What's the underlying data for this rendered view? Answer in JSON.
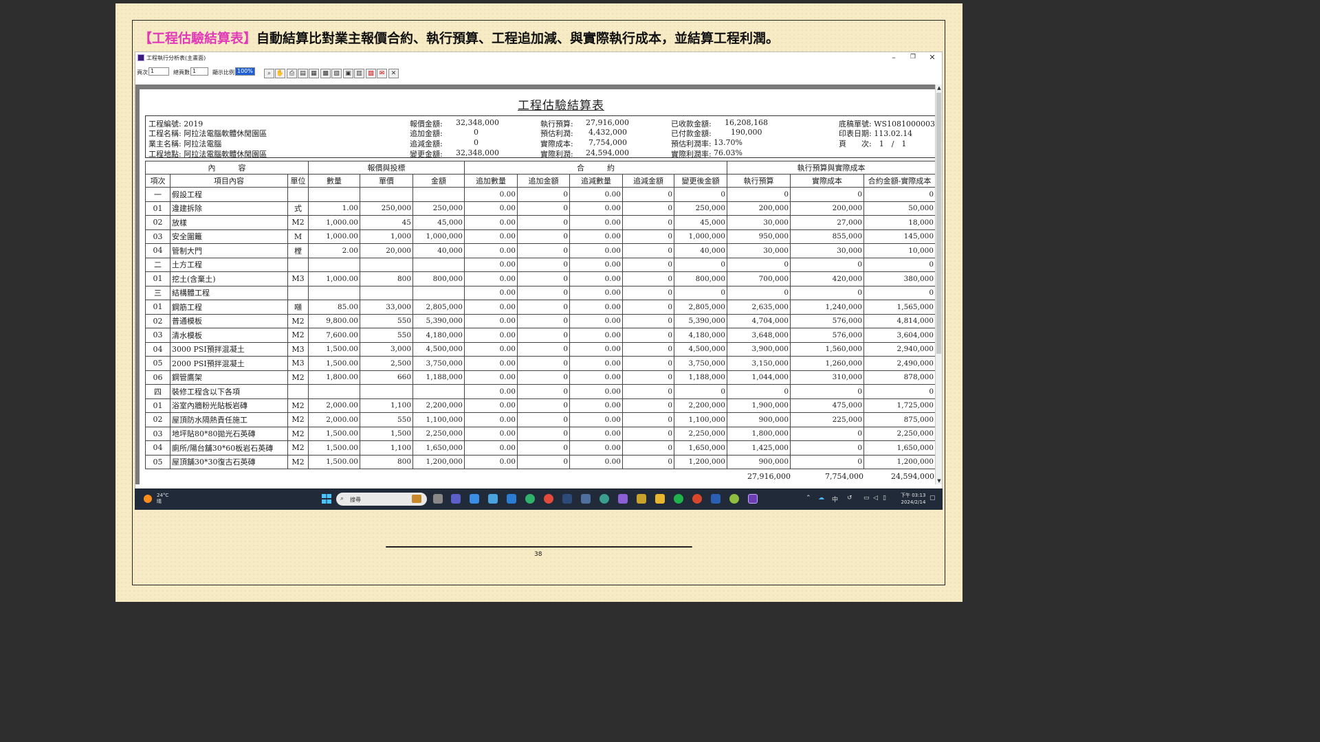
{
  "headline": {
    "tag": "【工程估驗結算表】",
    "text": "自動結算比對業主報價合約、執行預算、工程追加減、與實際執行成本，並結算工程利潤。"
  },
  "window": {
    "title": "工程執行分析表(主畫面)",
    "controls": {
      "minimize": "–",
      "restore": "❐",
      "close": "✕"
    }
  },
  "toolbar": {
    "page_label": "頁次",
    "page_value": "1",
    "total_label": "總頁數",
    "total_value": "1",
    "zoom_label": "顯示比例",
    "zoom_value": "100%"
  },
  "report": {
    "title": "工程估驗結算表",
    "info": {
      "project_no": "工程編號: 2019",
      "project_name": "工程名稱: 阿拉法電腦軟體休閒園區",
      "owner": "業主名稱: 阿拉法電腦",
      "location": "工程地點: 阿拉法電腦軟體休閒園區",
      "quote_label": "報價金額:",
      "quote_value": "32,348,000",
      "add_label": "追加金額:",
      "add_value": "0",
      "sub_label": "追減金額:",
      "sub_value": "0",
      "change_label": "變更金額:",
      "change_value": "32,348,000",
      "budget_label": "執行預算:",
      "budget_value": "27,916,000",
      "est_profit_label": "預估利潤:",
      "est_profit_value": "4,432,000",
      "actual_cost_label": "實際成本:",
      "actual_cost_value": "7,754,000",
      "actual_profit_label": "實際利潤:",
      "actual_profit_value": "24,594,000",
      "received_label": "已收款金額:",
      "received_value": "16,208,168",
      "paid_label": "已付款金額:",
      "paid_value": "190,000",
      "est_rate_label": "預估利潤率:",
      "est_rate_value": "13.70%",
      "actual_rate_label": "實際利潤率:",
      "actual_rate_value": "76.03%",
      "doc_no": "底稿單號: WS1081000003",
      "print_date": "印表日期: 113.02.14",
      "page_info": "頁　　次:　1　/　1"
    },
    "group_headers": {
      "content": "內　　　容",
      "quote": "報價與投標",
      "contract": "合　　　約",
      "budget": "執行預算與實際成本"
    },
    "columns": [
      "項次",
      "項目內容",
      "單位",
      "數量",
      "單價",
      "金額",
      "追加數量",
      "追加金額",
      "追減數量",
      "追減金額",
      "變更後金額",
      "執行預算",
      "實際成本",
      "合約金額-實際成本"
    ],
    "rows": [
      [
        "一",
        "假設工程",
        "",
        "",
        "",
        "",
        "0.00",
        "0",
        "0.00",
        "0",
        "0",
        "0",
        "0",
        "0"
      ],
      [
        "01",
        "違建拆除",
        "式",
        "1.00",
        "250,000",
        "250,000",
        "0.00",
        "0",
        "0.00",
        "0",
        "250,000",
        "200,000",
        "200,000",
        "50,000"
      ],
      [
        "02",
        "放樣",
        "M2",
        "1,000.00",
        "45",
        "45,000",
        "0.00",
        "0",
        "0.00",
        "0",
        "45,000",
        "30,000",
        "27,000",
        "18,000"
      ],
      [
        "03",
        "安全圍籬",
        "M",
        "1,000.00",
        "1,000",
        "1,000,000",
        "0.00",
        "0",
        "0.00",
        "0",
        "1,000,000",
        "950,000",
        "855,000",
        "145,000"
      ],
      [
        "04",
        "管制大門",
        "樘",
        "2.00",
        "20,000",
        "40,000",
        "0.00",
        "0",
        "0.00",
        "0",
        "40,000",
        "30,000",
        "30,000",
        "10,000"
      ],
      [
        "二",
        "土方工程",
        "",
        "",
        "",
        "",
        "0.00",
        "0",
        "0.00",
        "0",
        "0",
        "0",
        "0",
        "0"
      ],
      [
        "01",
        "挖土(含棄土)",
        "M3",
        "1,000.00",
        "800",
        "800,000",
        "0.00",
        "0",
        "0.00",
        "0",
        "800,000",
        "700,000",
        "420,000",
        "380,000"
      ],
      [
        "三",
        "結構體工程",
        "",
        "",
        "",
        "",
        "0.00",
        "0",
        "0.00",
        "0",
        "0",
        "0",
        "0",
        "0"
      ],
      [
        "01",
        "鋼筋工程",
        "噸",
        "85.00",
        "33,000",
        "2,805,000",
        "0.00",
        "0",
        "0.00",
        "0",
        "2,805,000",
        "2,635,000",
        "1,240,000",
        "1,565,000"
      ],
      [
        "02",
        "普通模板",
        "M2",
        "9,800.00",
        "550",
        "5,390,000",
        "0.00",
        "0",
        "0.00",
        "0",
        "5,390,000",
        "4,704,000",
        "576,000",
        "4,814,000"
      ],
      [
        "03",
        "清水模板",
        "M2",
        "7,600.00",
        "550",
        "4,180,000",
        "0.00",
        "0",
        "0.00",
        "0",
        "4,180,000",
        "3,648,000",
        "576,000",
        "3,604,000"
      ],
      [
        "04",
        "3000 PSI預拌混凝土",
        "M3",
        "1,500.00",
        "3,000",
        "4,500,000",
        "0.00",
        "0",
        "0.00",
        "0",
        "4,500,000",
        "3,900,000",
        "1,560,000",
        "2,940,000"
      ],
      [
        "05",
        "2000 PSI預拌混凝土",
        "M3",
        "1,500.00",
        "2,500",
        "3,750,000",
        "0.00",
        "0",
        "0.00",
        "0",
        "3,750,000",
        "3,150,000",
        "1,260,000",
        "2,490,000"
      ],
      [
        "06",
        "鋼管鷹架",
        "M2",
        "1,800.00",
        "660",
        "1,188,000",
        "0.00",
        "0",
        "0.00",
        "0",
        "1,188,000",
        "1,044,000",
        "310,000",
        "878,000"
      ],
      [
        "四",
        "裝修工程含以下各項",
        "",
        "",
        "",
        "",
        "0.00",
        "0",
        "0.00",
        "0",
        "0",
        "0",
        "0",
        "0"
      ],
      [
        "01",
        "浴室內牆粉光貼板岩磚",
        "M2",
        "2,000.00",
        "1,100",
        "2,200,000",
        "0.00",
        "0",
        "0.00",
        "0",
        "2,200,000",
        "1,900,000",
        "475,000",
        "1,725,000"
      ],
      [
        "02",
        "屋頂防水隔熱責任施工",
        "M2",
        "2,000.00",
        "550",
        "1,100,000",
        "0.00",
        "0",
        "0.00",
        "0",
        "1,100,000",
        "900,000",
        "225,000",
        "875,000"
      ],
      [
        "03",
        "地坪貼80*80拋光石英磚",
        "M2",
        "1,500.00",
        "1,500",
        "2,250,000",
        "0.00",
        "0",
        "0.00",
        "0",
        "2,250,000",
        "1,800,000",
        "0",
        "2,250,000"
      ],
      [
        "04",
        "廁所/陽台舖30*60板岩石英磚",
        "M2",
        "1,500.00",
        "1,100",
        "1,650,000",
        "0.00",
        "0",
        "0.00",
        "0",
        "1,650,000",
        "1,425,000",
        "0",
        "1,650,000"
      ],
      [
        "05",
        "屋頂舖30*30復古石英磚",
        "M2",
        "1,500.00",
        "800",
        "1,200,000",
        "0.00",
        "0",
        "0.00",
        "0",
        "1,200,000",
        "900,000",
        "0",
        "1,200,000"
      ]
    ],
    "totals": {
      "budget": "27,916,000",
      "actual": "7,754,000",
      "profit": "24,594,000"
    }
  },
  "taskbar": {
    "temp": "24°C",
    "weather": "晴",
    "search_placeholder": "搜尋",
    "ime": "中",
    "time": "下午 03:13",
    "date": "2024/2/14"
  },
  "page_number": "38",
  "colors": {
    "tag": "#e13ab8",
    "paper": "#f6ebc4",
    "taskbar": "#202a38"
  }
}
